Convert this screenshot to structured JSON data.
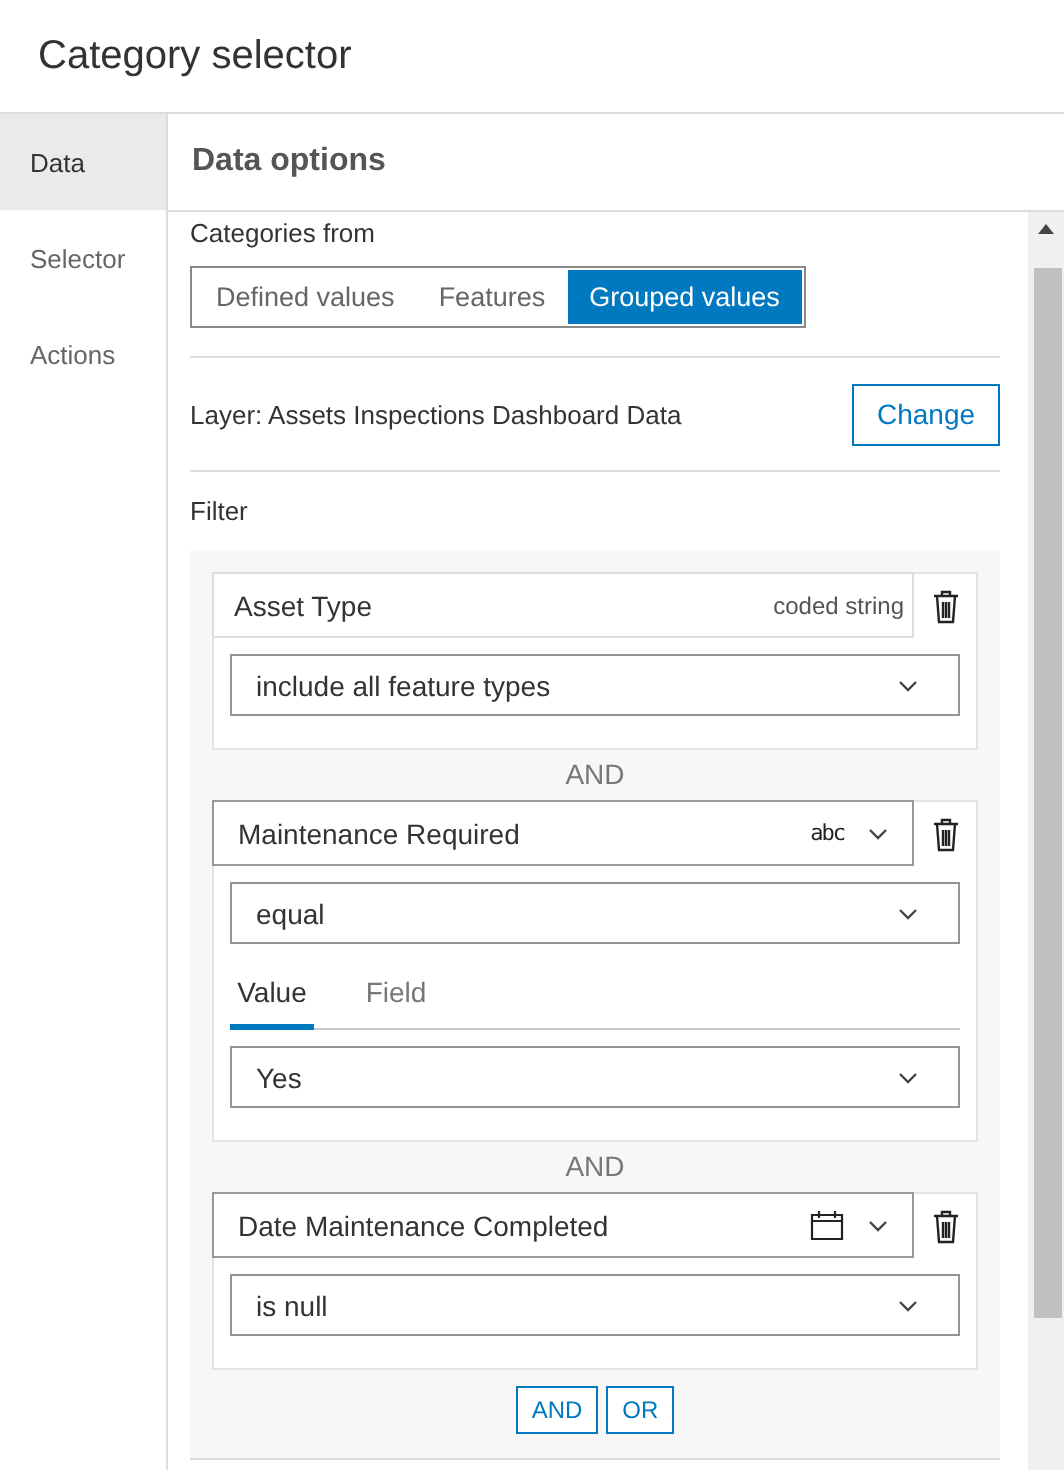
{
  "window": {
    "title": "Category selector"
  },
  "sidebar": {
    "items": [
      {
        "label": "Data",
        "selected": true
      },
      {
        "label": "Selector",
        "selected": false
      },
      {
        "label": "Actions",
        "selected": false
      }
    ]
  },
  "panel": {
    "title": "Data options"
  },
  "categories_from": {
    "label": "Categories from",
    "options": [
      {
        "label": "Defined values",
        "selected": false
      },
      {
        "label": "Features",
        "selected": false
      },
      {
        "label": "Grouped values",
        "selected": true
      }
    ]
  },
  "layer": {
    "label": "Layer: Assets Inspections Dashboard Data",
    "button": "Change"
  },
  "filter": {
    "label": "Filter",
    "conditions": [
      {
        "field": "Asset Type",
        "kind": "coded",
        "type_label": "coded string",
        "operator": "include all feature types"
      },
      {
        "field": "Maintenance Required",
        "kind": "string",
        "type_label": "abc",
        "operator": "equal",
        "value_tabs": [
          {
            "label": "Value",
            "selected": true
          },
          {
            "label": "Field",
            "selected": false
          }
        ],
        "value": "Yes"
      },
      {
        "field": "Date Maintenance Completed",
        "kind": "date",
        "operator": "is null"
      }
    ],
    "joiners": [
      "AND",
      "AND"
    ],
    "add_buttons": [
      "AND",
      "OR"
    ]
  }
}
